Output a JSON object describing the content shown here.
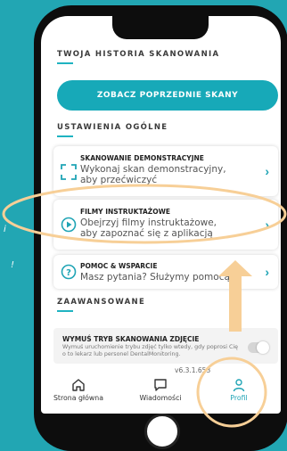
{
  "side_text": [
    "i",
    "!"
  ],
  "scan_history": {
    "section_title": "TWOJA HISTORIA SKANOWANIA",
    "button_label": "ZOBACZ POPRZEDNIE SKANY"
  },
  "general_settings": {
    "section_title": "USTAWIENIA OGÓLNE",
    "items": [
      {
        "title": "SKANOWANIE DEMONSTRACYJNE",
        "description": "Wykonaj skan demonstracyjny, aby przećwiczyć",
        "icon": "scan-frame-icon"
      },
      {
        "title": "FILMY INSTRUKTAŻOWE",
        "description": "Obejrzyj filmy instruktażowe, aby zapoznać się z aplikacją",
        "icon": "play-circle-icon"
      },
      {
        "title": "POMOC & WSPARCIE",
        "description": "Masz pytania? Służymy pomocą",
        "icon": "help-circle-icon"
      }
    ]
  },
  "advanced": {
    "section_title": "ZAAWANSOWANE",
    "toggle_title": "WYMUŚ TRYB SKANOWANIA ZDJĘCIE",
    "toggle_description": "Wymuś uruchomienie trybu zdjęć tylko wtedy, gdy poprosi Cię o to lekarz lub personel DentalMonitoring.",
    "toggle_on": false
  },
  "version": "v6.3.1.653",
  "tabs": [
    {
      "label": "Strona główna",
      "icon": "home-icon",
      "active": false
    },
    {
      "label": "Wiadomości",
      "icon": "message-icon",
      "active": false
    },
    {
      "label": "Profil",
      "icon": "person-icon",
      "active": true
    }
  ],
  "colors": {
    "background": "#22a6b3",
    "accent": "#17a9b8",
    "highlight": "#f7cf97"
  }
}
